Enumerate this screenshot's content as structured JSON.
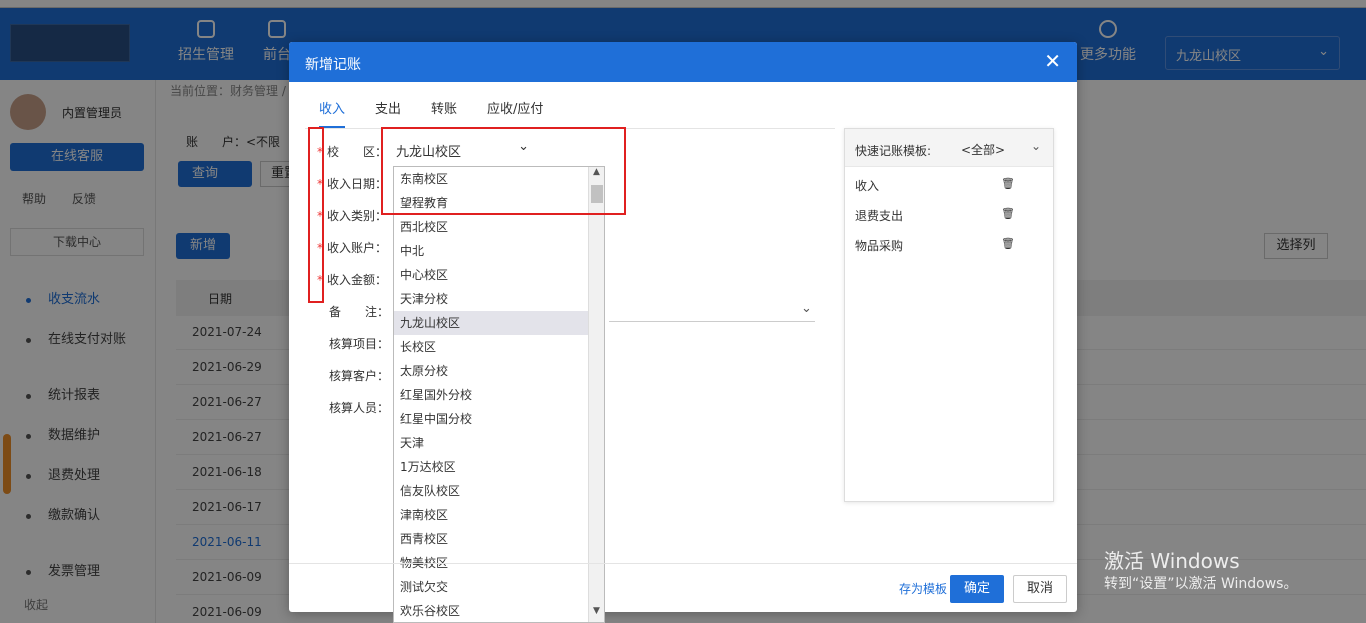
{
  "header": {
    "nav_items": [
      "招生管理",
      "前台",
      "",
      "",
      "",
      "",
      "",
      "",
      "",
      "",
      "",
      "",
      "更多功能"
    ],
    "campus_value": "九龙山校区"
  },
  "sidebar": {
    "user_name": "内置管理员",
    "online_service": "在线客服",
    "help": "帮助",
    "feedback": "反馈",
    "download_center": "下载中心",
    "menu": [
      "收支流水",
      "在线支付对账",
      "统计报表",
      "数据维护",
      "退费处理",
      "缴款确认",
      "发票管理"
    ],
    "collapse": "收起"
  },
  "main": {
    "breadcrumb": "当前位置：财务管理 /",
    "account_label": "账　　户：<不限",
    "query_button": "查询",
    "reset_button": "重置",
    "add_button": "新增",
    "select_columns_button": "选择列",
    "date_header": "日期",
    "rows": [
      {
        "date": "2021-07-24"
      },
      {
        "date": "2021-06-29"
      },
      {
        "date": "2021-06-27"
      },
      {
        "date": "2021-06-27"
      },
      {
        "date": "2021-06-18"
      },
      {
        "date": "2021-06-17"
      },
      {
        "date": "2021-06-11"
      },
      {
        "date": "2021-06-09"
      },
      {
        "date": "2021-06-09"
      }
    ]
  },
  "watermark": {
    "line1": "激活 Windows",
    "line2": "转到“设置”以激活 Windows。"
  },
  "modal": {
    "title": "新增记账",
    "close_label": "✕",
    "tabs": [
      "收入",
      "支出",
      "转账",
      "应收/应付"
    ],
    "active_tab": "收入",
    "labels": {
      "campus": "校　　区：",
      "income_date": "收入日期：",
      "income_category": "收入类别：",
      "income_account": "收入账户：",
      "income_amount": "收入金额：",
      "note": "备　　注：",
      "accounting_project": "核算项目：",
      "accounting_customer": "核算客户：",
      "accounting_staff": "核算人员："
    },
    "campus_value": "九龙山校区",
    "campus_options": [
      "东南校区",
      "望程教育",
      "西北校区",
      "中北",
      "中心校区",
      "天津分校",
      "九龙山校区",
      "长校区",
      "太原分校",
      "红星国外分校",
      "红星中国分校",
      "天津",
      "1万达校区",
      "信友队校区",
      "津南校区",
      "西青校区",
      "物美校区",
      "测试欠交",
      "欢乐谷校区"
    ],
    "selected_option": "九龙山校区",
    "template_panel": {
      "label": "快速记账模板:",
      "filter_value": "<全部>",
      "items": [
        "收入",
        "退费支出",
        "物品采购"
      ]
    },
    "footer": {
      "save_template": "存为模板",
      "ok": "确定",
      "cancel": "取消"
    }
  },
  "colors": {
    "primary": "#1f6fd8",
    "highlight": "#e02020",
    "required": "#e33"
  }
}
